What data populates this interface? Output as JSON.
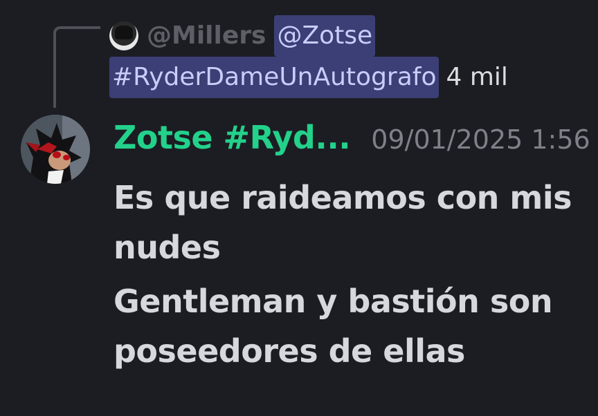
{
  "reply": {
    "author": "@Millers",
    "mention": "@Zotse",
    "channel_tag": "#RyderDameUnAutografo",
    "tail": "4 mil",
    "avatar_icon": "anime-avatar-icon"
  },
  "message": {
    "username": "Zotse #Ryd...",
    "timestamp": "09/01/2025 1:56",
    "username_color": "#23d18b",
    "lines": [
      "Es que raideamos con mis nudes",
      "Gentleman y bastión son poseedores de ellas"
    ]
  }
}
